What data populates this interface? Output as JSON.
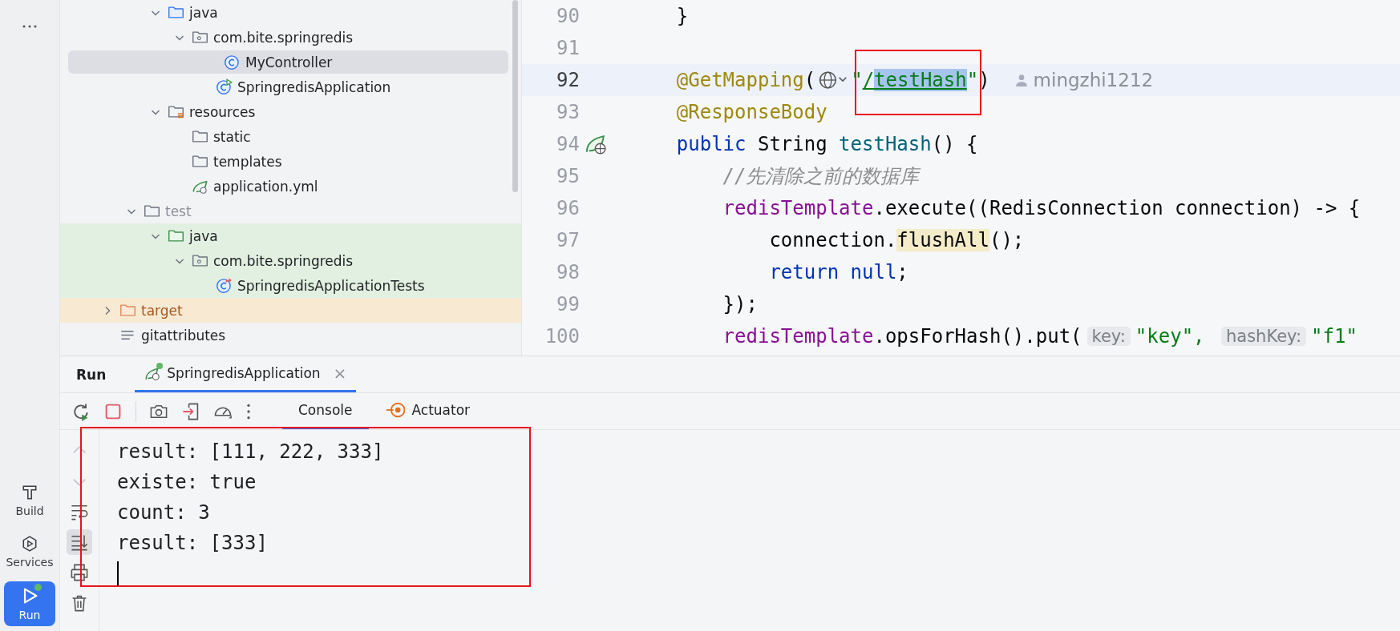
{
  "tool_windows": [
    {
      "kind": "build",
      "label": "Build",
      "selected": false
    },
    {
      "kind": "services",
      "label": "Services",
      "selected": false
    },
    {
      "kind": "run",
      "label": "Run",
      "selected": true,
      "running": true
    }
  ],
  "project_tree": {
    "items": [
      {
        "children": [
          {
            "children": [
              {
                "label": "java",
                "kind": "source-folder",
                "expanded": true,
                "selected": false,
                "children": [
                  {
                    "label": "com.bite.springredis",
                    "kind": "package",
                    "expanded": true,
                    "selected": false,
                    "children": [
                      {
                        "label": "MyController",
                        "kind": "class",
                        "selected": true
                      },
                      {
                        "label": "SpringredisApplication",
                        "kind": "class-run",
                        "selected": false
                      }
                    ]
                  }
                ]
              },
              {
                "label": "resources",
                "kind": "resource-folder",
                "expanded": true,
                "selected": false,
                "children": [
                  {
                    "label": "static",
                    "kind": "folder",
                    "selected": false
                  },
                  {
                    "label": "templates",
                    "kind": "folder",
                    "selected": false
                  },
                  {
                    "label": "application.yml",
                    "kind": "leaf-config",
                    "selected": false
                  }
                ]
              }
            ]
          },
          {
            "label": "test",
            "kind": "folder",
            "expanded": true,
            "selected": false,
            "dimmed": true,
            "children": [
              {
                "label": "java",
                "kind": "test-folder",
                "expanded": true,
                "selected": false,
                "children": [
                  {
                    "label": "com.bite.springredis",
                    "kind": "test-package",
                    "expanded": true,
                    "selected": false,
                    "children": [
                      {
                        "label": "SpringredisApplicationTests",
                        "kind": "class-test",
                        "selected": false
                      }
                    ]
                  }
                ]
              }
            ]
          }
        ]
      },
      {
        "label": "target",
        "kind": "excluded-folder",
        "expanded": false,
        "selected": false
      },
      {
        "label": "gitattributes",
        "kind": "text-file",
        "selected": false
      }
    ]
  },
  "editor": {
    "lines": [
      {
        "number": "90",
        "tokens": [
          {
            "kind": "plain",
            "text": "    }"
          }
        ]
      },
      {
        "number": "91"
      },
      {
        "number": "92",
        "current": true,
        "tokens": [
          {
            "kind": "annotation",
            "text": "    @GetMapping"
          },
          {
            "kind": "plain",
            "text": "("
          },
          {
            "kind": "globe-icon"
          },
          {
            "kind": "string",
            "text": "\""
          },
          {
            "kind": "link",
            "text": "/",
            "framed": true
          },
          {
            "kind": "string-selected",
            "text": "testHash"
          },
          {
            "kind": "string",
            "text": "\""
          },
          {
            "kind": "plain",
            "text": ")"
          },
          {
            "kind": "author",
            "text": "mingzhi1212"
          }
        ]
      },
      {
        "number": "93",
        "tokens": [
          {
            "kind": "annotation",
            "text": "    @ResponseBody"
          }
        ]
      },
      {
        "number": "94",
        "kind": "endpoint",
        "tokens": [
          {
            "kind": "keyword",
            "text": "    public"
          },
          {
            "kind": "plain",
            "text": " String "
          },
          {
            "kind": "declaration",
            "text": "testHash"
          },
          {
            "kind": "plain",
            "text": "() {"
          }
        ]
      },
      {
        "number": "95",
        "tokens": [
          {
            "kind": "comment",
            "text": "        //先清除之前的数据库"
          }
        ]
      },
      {
        "number": "96",
        "tokens": [
          {
            "kind": "field",
            "text": "        redisTemplate"
          },
          {
            "kind": "plain",
            "text": ".execute((RedisConnection connection) -> {"
          }
        ]
      },
      {
        "number": "97",
        "tokens": [
          {
            "kind": "plain",
            "text": "            connection."
          },
          {
            "kind": "usage",
            "text": "flushAll"
          },
          {
            "kind": "plain",
            "text": "();"
          }
        ]
      },
      {
        "number": "98",
        "tokens": [
          {
            "kind": "keyword",
            "text": "            return null"
          },
          {
            "kind": "plain",
            "text": ";"
          }
        ]
      },
      {
        "number": "99",
        "tokens": [
          {
            "kind": "plain",
            "text": "        });"
          }
        ]
      },
      {
        "number": "100",
        "tokens": [
          {
            "kind": "field",
            "text": "        redisTemplate"
          },
          {
            "kind": "plain",
            "text": ".opsForHash().put("
          },
          {
            "kind": "hint",
            "text": "key:"
          },
          {
            "kind": "string",
            "text": "\"key\", "
          },
          {
            "kind": "hint",
            "text": "hashKey:"
          },
          {
            "kind": "string",
            "text": "\"f1\""
          }
        ]
      }
    ]
  },
  "run_panel": {
    "title": "Run",
    "tabs": [
      {
        "label": "SpringredisApplication",
        "selected": true,
        "running": true,
        "close": "×"
      }
    ],
    "views": [
      {
        "kind": "console",
        "label": "Console",
        "selected": true
      },
      {
        "kind": "actuator",
        "label": "Actuator",
        "selected": false
      }
    ],
    "side_actions": [
      {
        "kind": "up",
        "disabled": true,
        "on": false
      },
      {
        "kind": "down",
        "disabled": true,
        "on": false
      },
      {
        "kind": "wrap",
        "disabled": false,
        "on": false
      },
      {
        "kind": "scroll-end",
        "disabled": false,
        "on": true
      },
      {
        "kind": "print",
        "disabled": false,
        "on": false
      },
      {
        "kind": "delete",
        "disabled": false,
        "on": false
      }
    ],
    "console_lines": [
      "result: [111, 222, 333]",
      "existe: true",
      "count: 3",
      "result: [333]"
    ]
  }
}
